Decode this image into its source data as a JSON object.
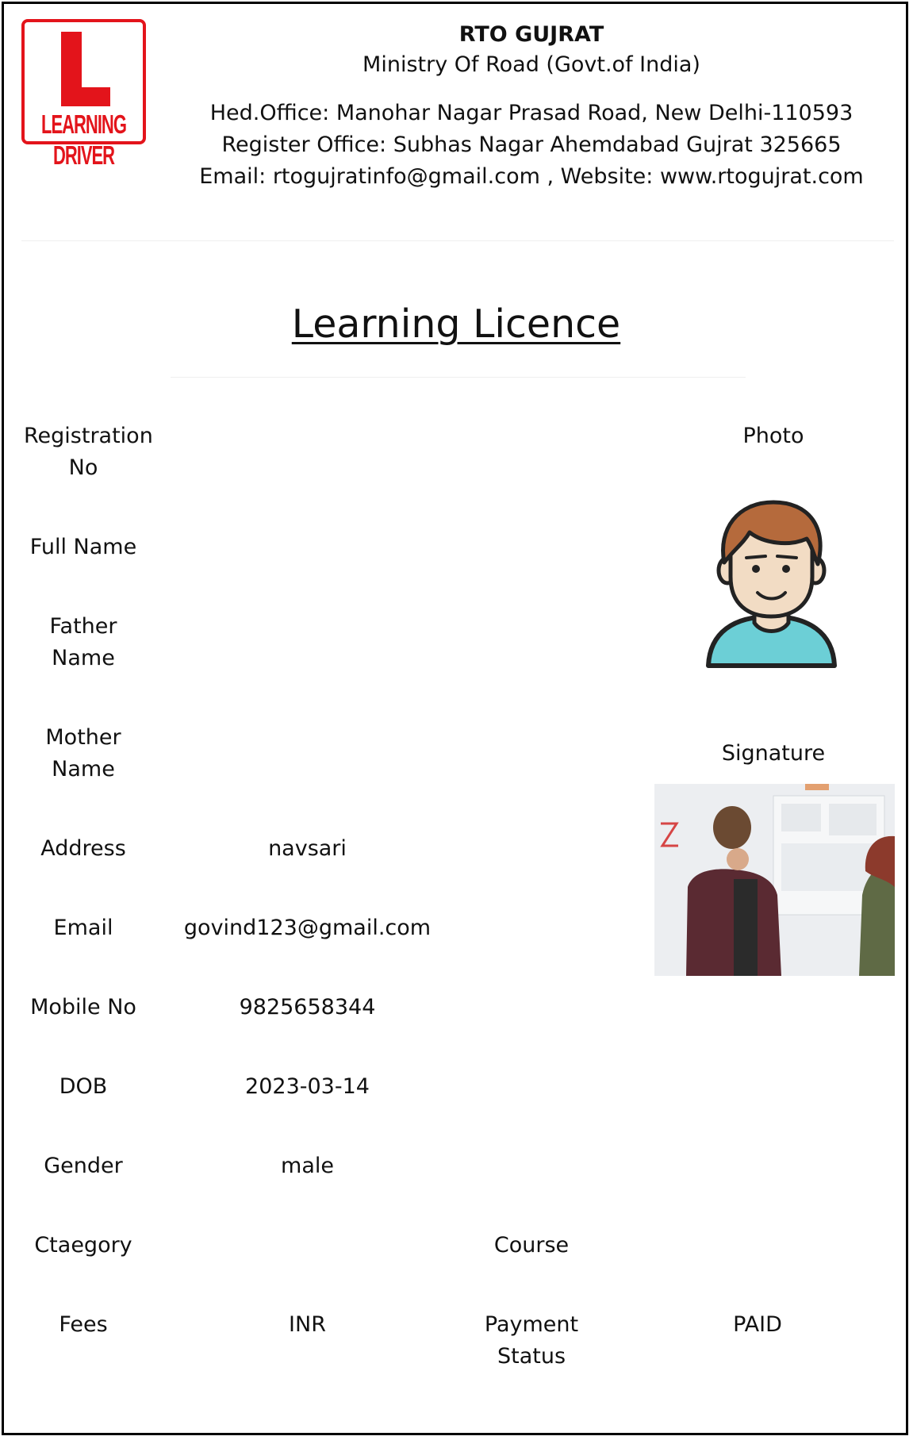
{
  "header": {
    "logo_text": "LEARNING DRIVER",
    "title": "RTO GUJRAT",
    "subtitle": "Ministry Of Road (Govt.of India)",
    "head_office": "Hed.Office: Manohar Nagar Prasad Road, New Delhi-110593",
    "register_office": "Register Office: Subhas Nagar Ahemdabad Gujrat 325665",
    "contact": "Email: rtogujratinfo@gmail.com , Website: www.rtogujrat.com"
  },
  "document_title": "Learning Licence",
  "fields": {
    "registration_no": {
      "label": "Registration No",
      "value": ""
    },
    "full_name": {
      "label": "Full Name",
      "value": ""
    },
    "father_name": {
      "label": "Father Name",
      "value": ""
    },
    "mother_name": {
      "label": "Mother Name",
      "value": ""
    },
    "address": {
      "label": "Address",
      "value": "navsari"
    },
    "email": {
      "label": "Email",
      "value": "govind123@gmail.com"
    },
    "mobile_no": {
      "label": "Mobile No",
      "value": "9825658344"
    },
    "dob": {
      "label": "DOB",
      "value": "2023-03-14"
    },
    "gender": {
      "label": "Gender",
      "value": "male"
    },
    "category": {
      "label": "Ctaegory",
      "value": ""
    },
    "course": {
      "label": "Course",
      "value": ""
    },
    "fees": {
      "label": "Fees",
      "value": "INR"
    },
    "payment_status": {
      "label": "Payment Status",
      "value": "PAID"
    }
  },
  "photo_label": "Photo",
  "signature_label": "Signature",
  "colors": {
    "logo_red": "#e3141b",
    "avatar_shirt": "#6ccfd6",
    "avatar_hair": "#b56a3c",
    "avatar_skin": "#f2dcc4"
  },
  "icons": {
    "avatar": "user-avatar-icon",
    "logo": "learning-driver-logo"
  }
}
